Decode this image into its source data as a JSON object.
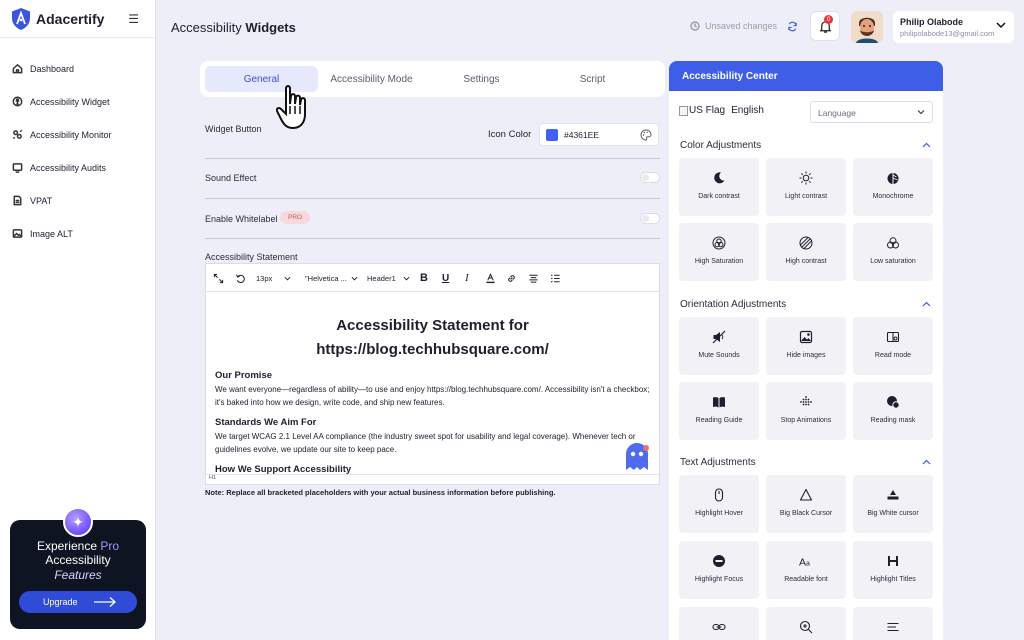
{
  "sidebar": {
    "brand": "Adacertify",
    "items": [
      {
        "label": "Dashboard",
        "icon": "home-icon"
      },
      {
        "label": "Accessibility Widget",
        "icon": "widget-icon"
      },
      {
        "label": "Accessibility Monitor",
        "icon": "monitor-icon"
      },
      {
        "label": "Accessibility Audits",
        "icon": "audit-icon"
      },
      {
        "label": "VPAT",
        "icon": "document-icon"
      },
      {
        "label": "Image ALT",
        "icon": "image-icon"
      }
    ],
    "promo": {
      "line1_prefix": "Experience",
      "line1_accent": "Pro",
      "line2": "Accessibility",
      "line3": "Features",
      "button": "Upgrade"
    }
  },
  "header": {
    "title_regular": "Accessibility",
    "title_bold": "Widgets",
    "unsaved": "Unsaved changes",
    "notification_count": "0",
    "user_name": "Philip Olabode",
    "user_email": "philipolabode13@gmail.com"
  },
  "tabs": [
    "General",
    "Accessibility Mode",
    "Settings",
    "Script"
  ],
  "active_tab": "General",
  "general": {
    "widget_button": "Widget Button",
    "icon_color_label": "Icon Color",
    "icon_color_value": "#4361EE",
    "sound_effect": "Sound Effect",
    "enable_whitelabel": "Enable Whitelabel",
    "pro_badge": "PRO",
    "statement_label": "Accessibility Statement",
    "note": "Note: Replace all bracketed placeholders with your actual business information before publishing."
  },
  "editor": {
    "font_size": "13px",
    "font_family": "\"Helvetica ...",
    "heading": "Header1",
    "status": "H1",
    "doc_title_line1": "Accessibility Statement for",
    "doc_title_line2": "https://blog.techhubsquare.com/",
    "h_promise": "Our Promise",
    "p_promise": "We want everyone—regardless of ability—to use and enjoy https://blog.techhubsquare.com/. Accessibility isn't a checkbox; it's baked into how we design, write code, and ship new features.",
    "h_standards": "Standards We Aim For",
    "p_standards": "We target WCAG 2.1 Level AA compliance (the industry sweet spot for usability and legal coverage). Whenever tech or guidelines evolve, we update our site to keep pace.",
    "h_support": "How We Support Accessibility"
  },
  "panel": {
    "title": "Accessibility Center",
    "flag_alt": "US Flag",
    "language_name": "English",
    "language_select": "Language",
    "color_section": "Color Adjustments",
    "color_tiles": [
      "Dark contrast",
      "Light contrast",
      "Monochrome",
      "High Saturation",
      "High contrast",
      "Low saturation"
    ],
    "orientation_section": "Orientation Adjustments",
    "orientation_tiles": [
      "Mute Sounds",
      "Hide images",
      "Read mode",
      "Reading Guide",
      "Stop Animations",
      "Reading mask"
    ],
    "text_section": "Text Adjustments",
    "text_tiles": [
      "Highlight Hover",
      "Big Black Cursor",
      "Big White cursor",
      "Highlight Focus",
      "Readable font",
      "Highlight Titles"
    ]
  },
  "colors": {
    "accent": "#3f5ee7",
    "icon_color": "#4361EE",
    "promo_bg": "#0e1421",
    "upgrade_button": "#2f4bd8"
  }
}
